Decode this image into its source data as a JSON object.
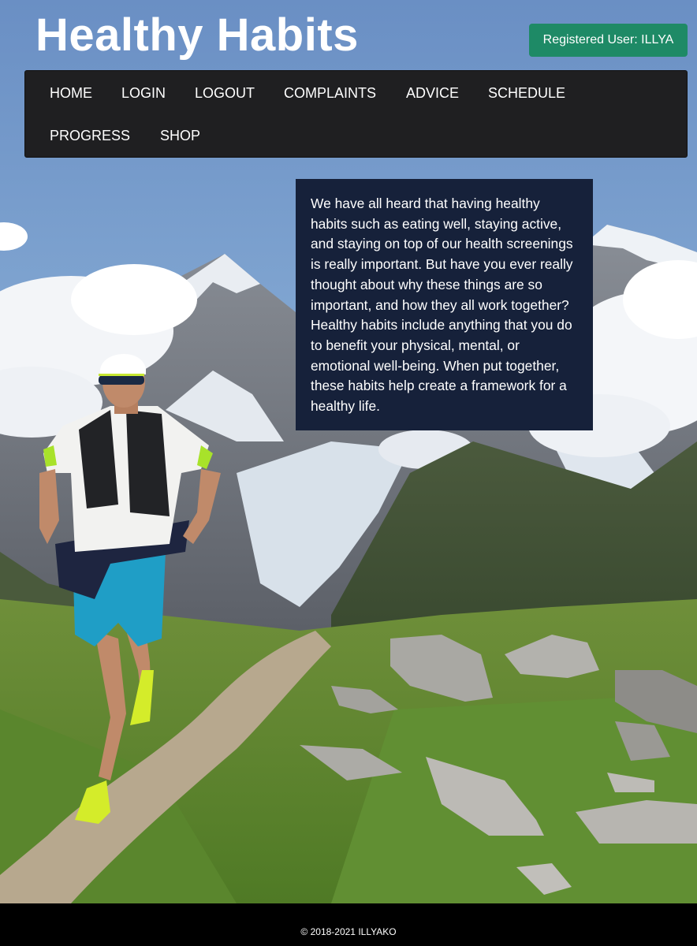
{
  "header": {
    "title": "Healthy Habits",
    "user_badge": "Registered User: ILLYA"
  },
  "nav": {
    "items": [
      {
        "label": "HOME",
        "icon": ""
      },
      {
        "label": "LOGIN",
        "icon": ""
      },
      {
        "label": "LOGOUT",
        "icon": ""
      },
      {
        "label": "COMPLAINTS",
        "icon": ""
      },
      {
        "label": "ADVICE",
        "icon": ""
      },
      {
        "label": "SCHEDULE",
        "icon": ""
      },
      {
        "label": "PROGRESS",
        "icon": ""
      },
      {
        "label": "SHOP",
        "icon": ""
      }
    ]
  },
  "main": {
    "info_text": "We have all heard that having healthy habits such as eating well, staying active, and staying on top of our health screenings is really important. But have you ever really thought about why these things are so important, and how they all work together? Healthy habits include anything that you do to benefit your physical, mental, or emotional well-being. When put together, these habits help create a framework for a healthy life."
  },
  "footer": {
    "copyright": "© 2018-2021 ILLYAKO"
  },
  "colors": {
    "badge": "#1e8a66",
    "navbar": "#1f1f21",
    "panel": "#16213a",
    "footer": "#000000"
  }
}
